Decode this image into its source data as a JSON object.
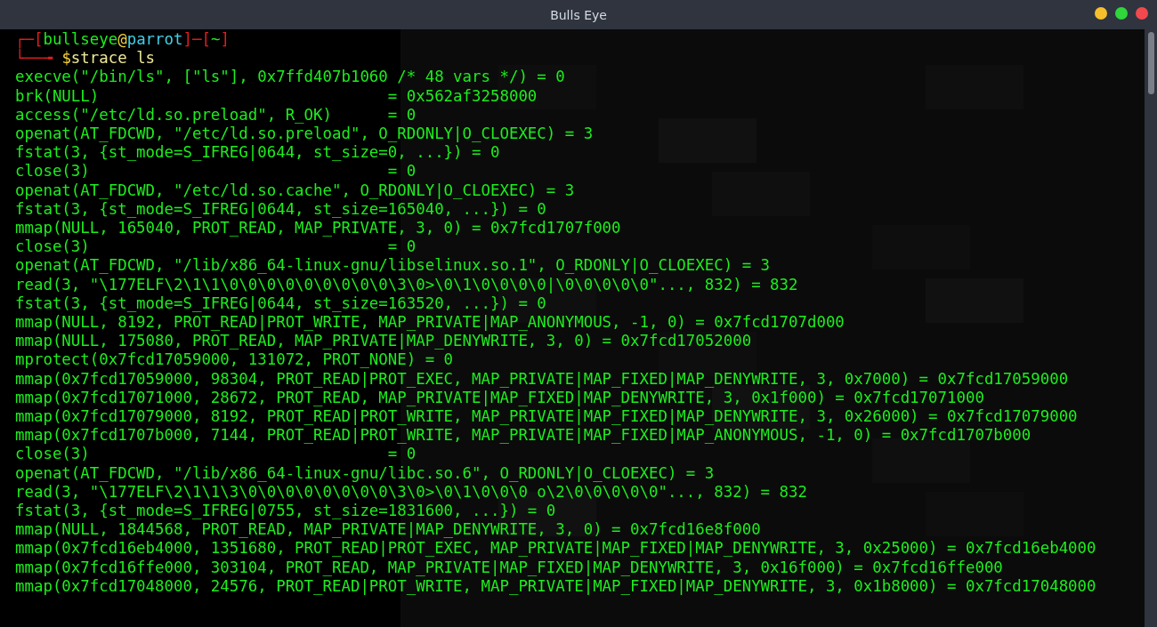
{
  "window": {
    "title": "Bulls Eye",
    "controls": [
      {
        "color": "#f5c02c"
      },
      {
        "color": "#2fd63c"
      },
      {
        "color": "#f2494f"
      }
    ]
  },
  "prompt": {
    "open": "┌─[",
    "user": "bullseye",
    "at": "@",
    "host": "parrot",
    "mid": "]─[",
    "cwd": "~",
    "close": "]",
    "corner": "└──╼",
    "symbol": "$",
    "command": "strace ls"
  },
  "output": [
    "execve(\"/bin/ls\", [\"ls\"], 0x7ffd407b1060 /* 48 vars */) = 0",
    "brk(NULL)                               = 0x562af3258000",
    "access(\"/etc/ld.so.preload\", R_OK)      = 0",
    "openat(AT_FDCWD, \"/etc/ld.so.preload\", O_RDONLY|O_CLOEXEC) = 3",
    "fstat(3, {st_mode=S_IFREG|0644, st_size=0, ...}) = 0",
    "close(3)                                = 0",
    "openat(AT_FDCWD, \"/etc/ld.so.cache\", O_RDONLY|O_CLOEXEC) = 3",
    "fstat(3, {st_mode=S_IFREG|0644, st_size=165040, ...}) = 0",
    "mmap(NULL, 165040, PROT_READ, MAP_PRIVATE, 3, 0) = 0x7fcd1707f000",
    "close(3)                                = 0",
    "openat(AT_FDCWD, \"/lib/x86_64-linux-gnu/libselinux.so.1\", O_RDONLY|O_CLOEXEC) = 3",
    "read(3, \"\\177ELF\\2\\1\\1\\0\\0\\0\\0\\0\\0\\0\\0\\0\\3\\0>\\0\\1\\0\\0\\0\\0|\\0\\0\\0\\0\\0\"..., 832) = 832",
    "fstat(3, {st_mode=S_IFREG|0644, st_size=163520, ...}) = 0",
    "mmap(NULL, 8192, PROT_READ|PROT_WRITE, MAP_PRIVATE|MAP_ANONYMOUS, -1, 0) = 0x7fcd1707d000",
    "mmap(NULL, 175080, PROT_READ, MAP_PRIVATE|MAP_DENYWRITE, 3, 0) = 0x7fcd17052000",
    "mprotect(0x7fcd17059000, 131072, PROT_NONE) = 0",
    "mmap(0x7fcd17059000, 98304, PROT_READ|PROT_EXEC, MAP_PRIVATE|MAP_FIXED|MAP_DENYWRITE, 3, 0x7000) = 0x7fcd17059000",
    "mmap(0x7fcd17071000, 28672, PROT_READ, MAP_PRIVATE|MAP_FIXED|MAP_DENYWRITE, 3, 0x1f000) = 0x7fcd17071000",
    "mmap(0x7fcd17079000, 8192, PROT_READ|PROT_WRITE, MAP_PRIVATE|MAP_FIXED|MAP_DENYWRITE, 3, 0x26000) = 0x7fcd17079000",
    "mmap(0x7fcd1707b000, 7144, PROT_READ|PROT_WRITE, MAP_PRIVATE|MAP_FIXED|MAP_ANONYMOUS, -1, 0) = 0x7fcd1707b000",
    "close(3)                                = 0",
    "openat(AT_FDCWD, \"/lib/x86_64-linux-gnu/libc.so.6\", O_RDONLY|O_CLOEXEC) = 3",
    "read(3, \"\\177ELF\\2\\1\\1\\3\\0\\0\\0\\0\\0\\0\\0\\0\\3\\0>\\0\\1\\0\\0\\0 o\\2\\0\\0\\0\\0\\0\"..., 832) = 832",
    "fstat(3, {st_mode=S_IFREG|0755, st_size=1831600, ...}) = 0",
    "mmap(NULL, 1844568, PROT_READ, MAP_PRIVATE|MAP_DENYWRITE, 3, 0) = 0x7fcd16e8f000",
    "mmap(0x7fcd16eb4000, 1351680, PROT_READ|PROT_EXEC, MAP_PRIVATE|MAP_FIXED|MAP_DENYWRITE, 3, 0x25000) = 0x7fcd16eb4000",
    "mmap(0x7fcd16ffe000, 303104, PROT_READ, MAP_PRIVATE|MAP_FIXED|MAP_DENYWRITE, 3, 0x16f000) = 0x7fcd16ffe000",
    "mmap(0x7fcd17048000, 24576, PROT_READ|PROT_WRITE, MAP_PRIVATE|MAP_FIXED|MAP_DENYWRITE, 3, 0x1b8000) = 0x7fcd17048000"
  ]
}
